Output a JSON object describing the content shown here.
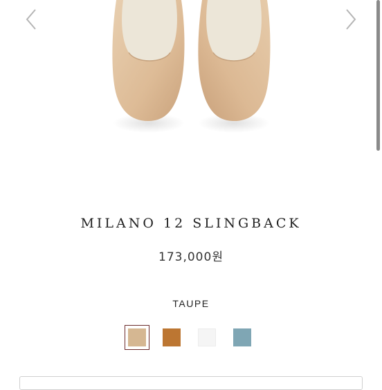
{
  "gallery": {
    "prev_icon": "chevron-left-icon",
    "next_icon": "chevron-right-icon",
    "image": "beige-flat-shoes-photo"
  },
  "product": {
    "title": "MILANO 12 SLINGBACK",
    "price": "173,000원"
  },
  "colors": {
    "selected_name": "TAUPE",
    "options": [
      {
        "color": "#d5b792"
      },
      {
        "color": "#bc7632"
      },
      {
        "color": "#f5f5f5"
      },
      {
        "color": "#7fa6b4"
      }
    ]
  }
}
